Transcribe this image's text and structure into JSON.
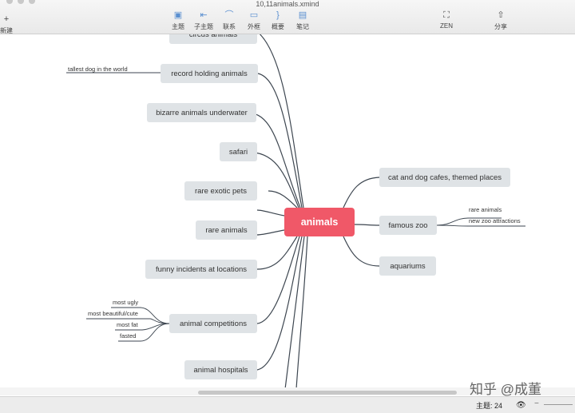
{
  "window": {
    "title": "10,11animals.xmind"
  },
  "toolbar": {
    "new_label": "新建",
    "items": [
      {
        "label": "主题",
        "icon": "topic-icon"
      },
      {
        "label": "子主题",
        "icon": "subtopic-icon"
      },
      {
        "label": "联系",
        "icon": "relationship-icon"
      },
      {
        "label": "外框",
        "icon": "boundary-icon"
      },
      {
        "label": "概要",
        "icon": "summary-icon"
      },
      {
        "label": "笔记",
        "icon": "notes-icon"
      }
    ],
    "zen_label": "ZEN",
    "share_label": "分享"
  },
  "map": {
    "central": "animals",
    "left_topics": [
      "circus animals",
      "record holding animals",
      "bizarre animals underwater",
      "safari",
      "rare exotic pets",
      "rare animals",
      "funny incidents at locations",
      "animal competitions",
      "animal hospitals"
    ],
    "right_topics": [
      "cat and dog cafes, themed places",
      "famous zoo",
      "aquariums"
    ],
    "leaves": {
      "record_holding": [
        "tallest dog in the world"
      ],
      "famous_zoo": [
        "rare animals",
        "new zoo attractions"
      ],
      "competitions": [
        "most ugly",
        "most beautiful/cute",
        "most fat",
        "fasted"
      ]
    }
  },
  "status": {
    "topic_count": "主题: 24"
  },
  "watermark": "知乎 @成董",
  "colors": {
    "central": "#f05868",
    "topic": "#dfe3e6",
    "line": "#3d4650"
  }
}
